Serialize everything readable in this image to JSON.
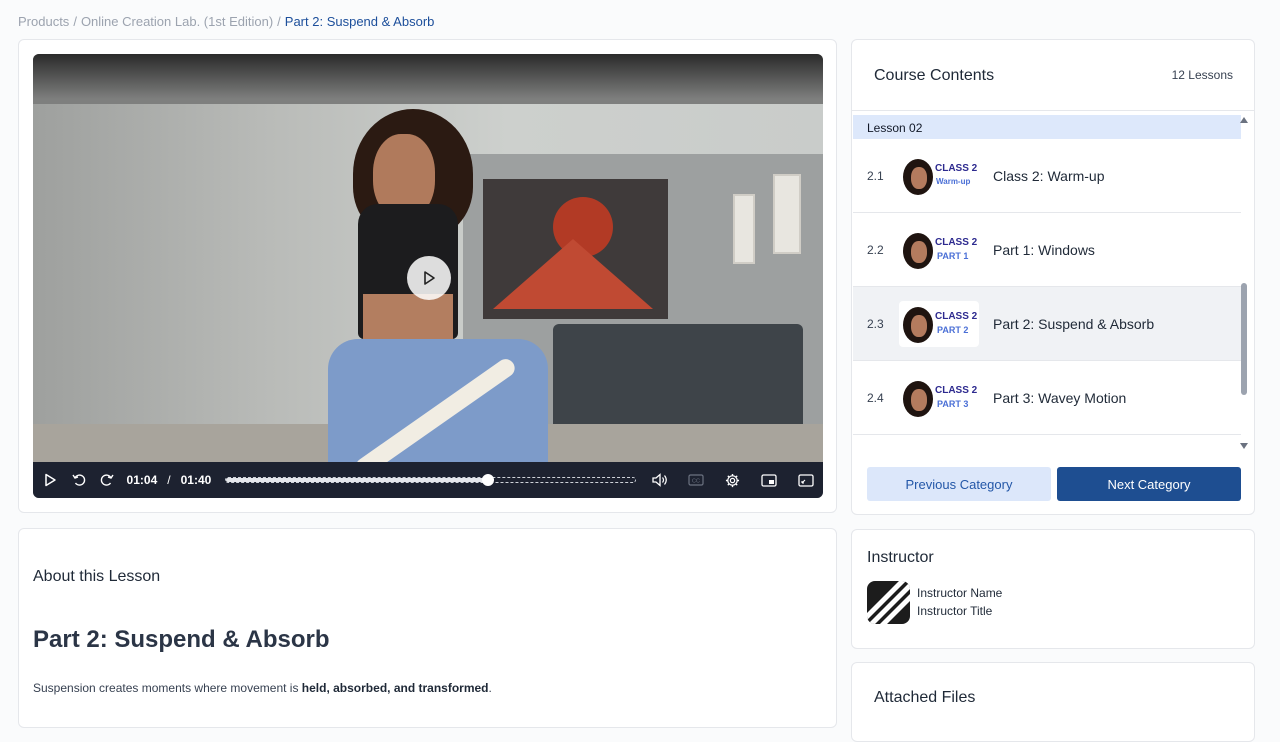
{
  "breadcrumb": {
    "items": [
      "Products",
      "Online Creation Lab. (1st Edition)"
    ],
    "current": "Part 2: Suspend & Absorb",
    "separator": "/"
  },
  "player": {
    "current_time": "01:04",
    "time_separator": "/",
    "duration": "01:40",
    "progress_fraction": 0.64,
    "icons": [
      "play-icon",
      "rewind-icon",
      "forward-icon",
      "volume-icon",
      "captions-icon",
      "settings-icon",
      "pip-icon",
      "fullscreen-icon"
    ]
  },
  "about": {
    "heading": "About this Lesson",
    "title": "Part 2: Suspend & Absorb",
    "description_prefix": "Suspension creates moments where movement is ",
    "description_bold": "held, absorbed, and transformed",
    "description_suffix": "."
  },
  "contents": {
    "title": "Course Contents",
    "count": "12 Lessons",
    "group_label": "Lesson 02",
    "items": [
      {
        "num": "2.1",
        "name": "Class 2: Warm-up",
        "thumb_line1": "CLASS 2",
        "thumb_line2": "Warm-up"
      },
      {
        "num": "2.2",
        "name": "Part 1: Windows",
        "thumb_line1": "CLASS 2",
        "thumb_line2": "PART 1"
      },
      {
        "num": "2.3",
        "name": "Part 2: Suspend & Absorb",
        "thumb_line1": "CLASS 2",
        "thumb_line2": "PART 2"
      },
      {
        "num": "2.4",
        "name": "Part 3: Wavey Motion",
        "thumb_line1": "CLASS 2",
        "thumb_line2": "PART 3"
      }
    ],
    "prev_label": "Previous Category",
    "next_label": "Next Category"
  },
  "instructor": {
    "heading": "Instructor",
    "name": "Instructor Name",
    "title": "Instructor Title"
  },
  "files": {
    "heading": "Attached Files"
  },
  "colors": {
    "accent": "#1e4e91",
    "accent_light": "#dce7fa",
    "group_bg": "#dde8fb",
    "player_bar": "#1d2230"
  }
}
